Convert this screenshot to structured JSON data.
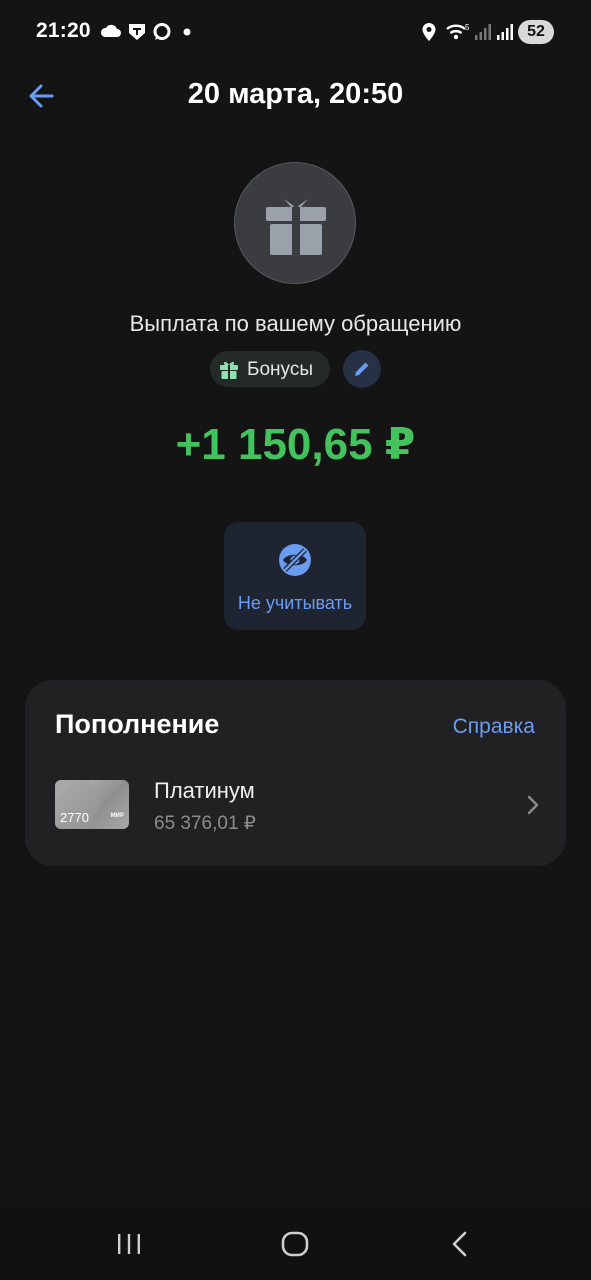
{
  "status_bar": {
    "time": "21:20",
    "battery": "52",
    "icons": [
      "cloud-icon",
      "t-bank-icon",
      "chat-bubble-icon",
      "notification-dot",
      "location-icon",
      "wifi-icon",
      "signal-icon",
      "signal-icon"
    ]
  },
  "header": {
    "back_icon": "arrow-left-icon",
    "title": "20 марта, 20:50"
  },
  "operation": {
    "icon": "gift-icon",
    "description": "Выплата по вашему обращению",
    "category": "Бонусы",
    "category_icon": "gift-icon",
    "edit_icon": "pencil-icon",
    "amount": "+1 150,65 ₽",
    "amount_color": "#43c25e"
  },
  "action": {
    "icon": "eye-off-icon",
    "label": "Не учитывать"
  },
  "panel": {
    "title": "Пополнение",
    "help": "Справка",
    "account": {
      "card_number": "2770",
      "card_brand": "МИР",
      "name": "Платинум",
      "balance": "65 376,01 ₽"
    }
  },
  "nav": {
    "recent": "recent-apps-icon",
    "home": "home-icon",
    "back": "back-icon"
  },
  "colors": {
    "background": "#141414",
    "accent": "#6c9cf0",
    "positive": "#43c25e"
  }
}
